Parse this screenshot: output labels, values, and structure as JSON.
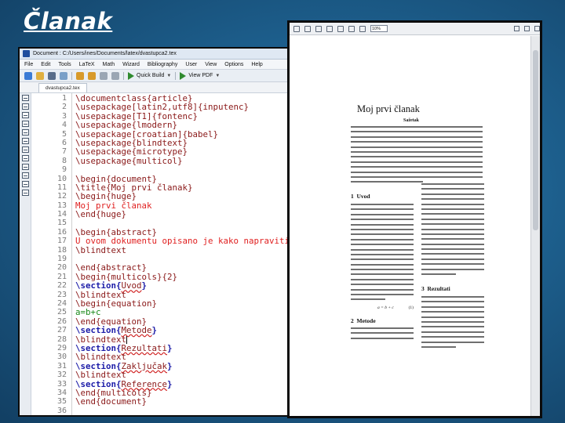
{
  "slide": {
    "title": "Članak"
  },
  "editor": {
    "title_bar": "Document : C:/Users/ines/Documents/latex/dvastupca2.tex",
    "menu": [
      "File",
      "Edit",
      "Tools",
      "LaTeX",
      "Math",
      "Wizard",
      "Bibliography",
      "User",
      "View",
      "Options",
      "Help"
    ],
    "toolbar": {
      "build_label": "Quick Build",
      "view_label": "View PDF"
    },
    "file_tab": "dvastupca2.tex",
    "line_numbers": [
      "1",
      "2",
      "3",
      "4",
      "5",
      "6",
      "7",
      "8",
      "9",
      "10",
      "11",
      "12",
      "13",
      "14",
      "15",
      "16",
      "17",
      "18",
      "19",
      "20",
      "21",
      "22",
      "23",
      "24",
      "25",
      "26",
      "27",
      "28",
      "29",
      "30",
      "31",
      "32",
      "33",
      "34",
      "35",
      "36"
    ],
    "code_lines": [
      [
        {
          "c": "cmd",
          "t": "\\documentclass{article}"
        }
      ],
      [
        {
          "c": "cmd",
          "t": "\\usepackage[latin2,utf8]{inputenc}"
        }
      ],
      [
        {
          "c": "cmd",
          "t": "\\usepackage[T1]{fontenc}"
        }
      ],
      [
        {
          "c": "cmd",
          "t": "\\usepackage{lmodern}"
        }
      ],
      [
        {
          "c": "cmd",
          "t": "\\usepackage[croatian]{babel}"
        }
      ],
      [
        {
          "c": "cmd",
          "t": "\\usepackage{blindtext}"
        }
      ],
      [
        {
          "c": "cmd",
          "t": "\\usepackage{microtype}"
        }
      ],
      [
        {
          "c": "cmd",
          "t": "\\usepackage{multicol}"
        }
      ],
      [],
      [
        {
          "c": "cmd",
          "t": "\\begin{document}"
        }
      ],
      [
        {
          "c": "cmd",
          "t": "\\title{Moj prvi članak}"
        }
      ],
      [
        {
          "c": "cmd",
          "t": "\\begin{huge}"
        }
      ],
      [
        {
          "c": "text-red",
          "t": "Moj prvi članak"
        }
      ],
      [
        {
          "c": "cmd",
          "t": "\\end{huge}"
        }
      ],
      [],
      [
        {
          "c": "cmd",
          "t": "\\begin{abstract}"
        }
      ],
      [
        {
          "c": "text-red",
          "t": "U ovom dokumentu opisano je kako napraviti"
        }
      ],
      [
        {
          "c": "cmd",
          "t": "\\blindtext"
        }
      ],
      [],
      [
        {
          "c": "cmd",
          "t": "\\end{abstract}"
        }
      ],
      [
        {
          "c": "cmd",
          "t": "\\begin{multicols}{2}"
        }
      ],
      [
        {
          "c": "sec-cmd",
          "t": "\\section{Uvod}"
        }
      ],
      [
        {
          "c": "cmd",
          "t": "\\blindtext"
        }
      ],
      [
        {
          "c": "cmd",
          "t": "\\begin{equation}"
        }
      ],
      [
        {
          "c": "math",
          "t": "a=b+c"
        }
      ],
      [
        {
          "c": "cmd",
          "t": "\\end{equation}"
        }
      ],
      [
        {
          "c": "sec-cmd",
          "t": "\\section{Metode}"
        }
      ],
      [
        {
          "c": "cmd",
          "t": "\\blindtext"
        },
        {
          "c": "cursor",
          "t": ""
        }
      ],
      [
        {
          "c": "sec-cmd",
          "t": "\\section{Rezultati}"
        }
      ],
      [
        {
          "c": "cmd",
          "t": "\\blindtext"
        }
      ],
      [
        {
          "c": "sec-cmd",
          "t": "\\section{Zaključak}"
        }
      ],
      [
        {
          "c": "cmd",
          "t": "\\blindtext"
        }
      ],
      [
        {
          "c": "sec-cmd",
          "t": "\\section{Reference}"
        }
      ],
      [
        {
          "c": "cmd",
          "t": "\\end{multicols}"
        }
      ],
      [
        {
          "c": "cmd",
          "t": "\\end{document}"
        }
      ],
      []
    ]
  },
  "viewer": {
    "zoom": "10%",
    "page": {
      "title": "Moj prvi članak",
      "abstract_label": "Sažetak",
      "sections": [
        {
          "num": "1",
          "name": "Uvod"
        },
        {
          "num": "2",
          "name": "Metode"
        },
        {
          "num": "3",
          "name": "Rezultati"
        }
      ],
      "equation": "a = b + c",
      "equation_number": "(1)"
    }
  },
  "colors": {
    "background": "#1d5f8d",
    "command": "#8a1818",
    "section": "#1c1ca8",
    "plain_text": "#e02020",
    "math": "#1a8a1a"
  }
}
